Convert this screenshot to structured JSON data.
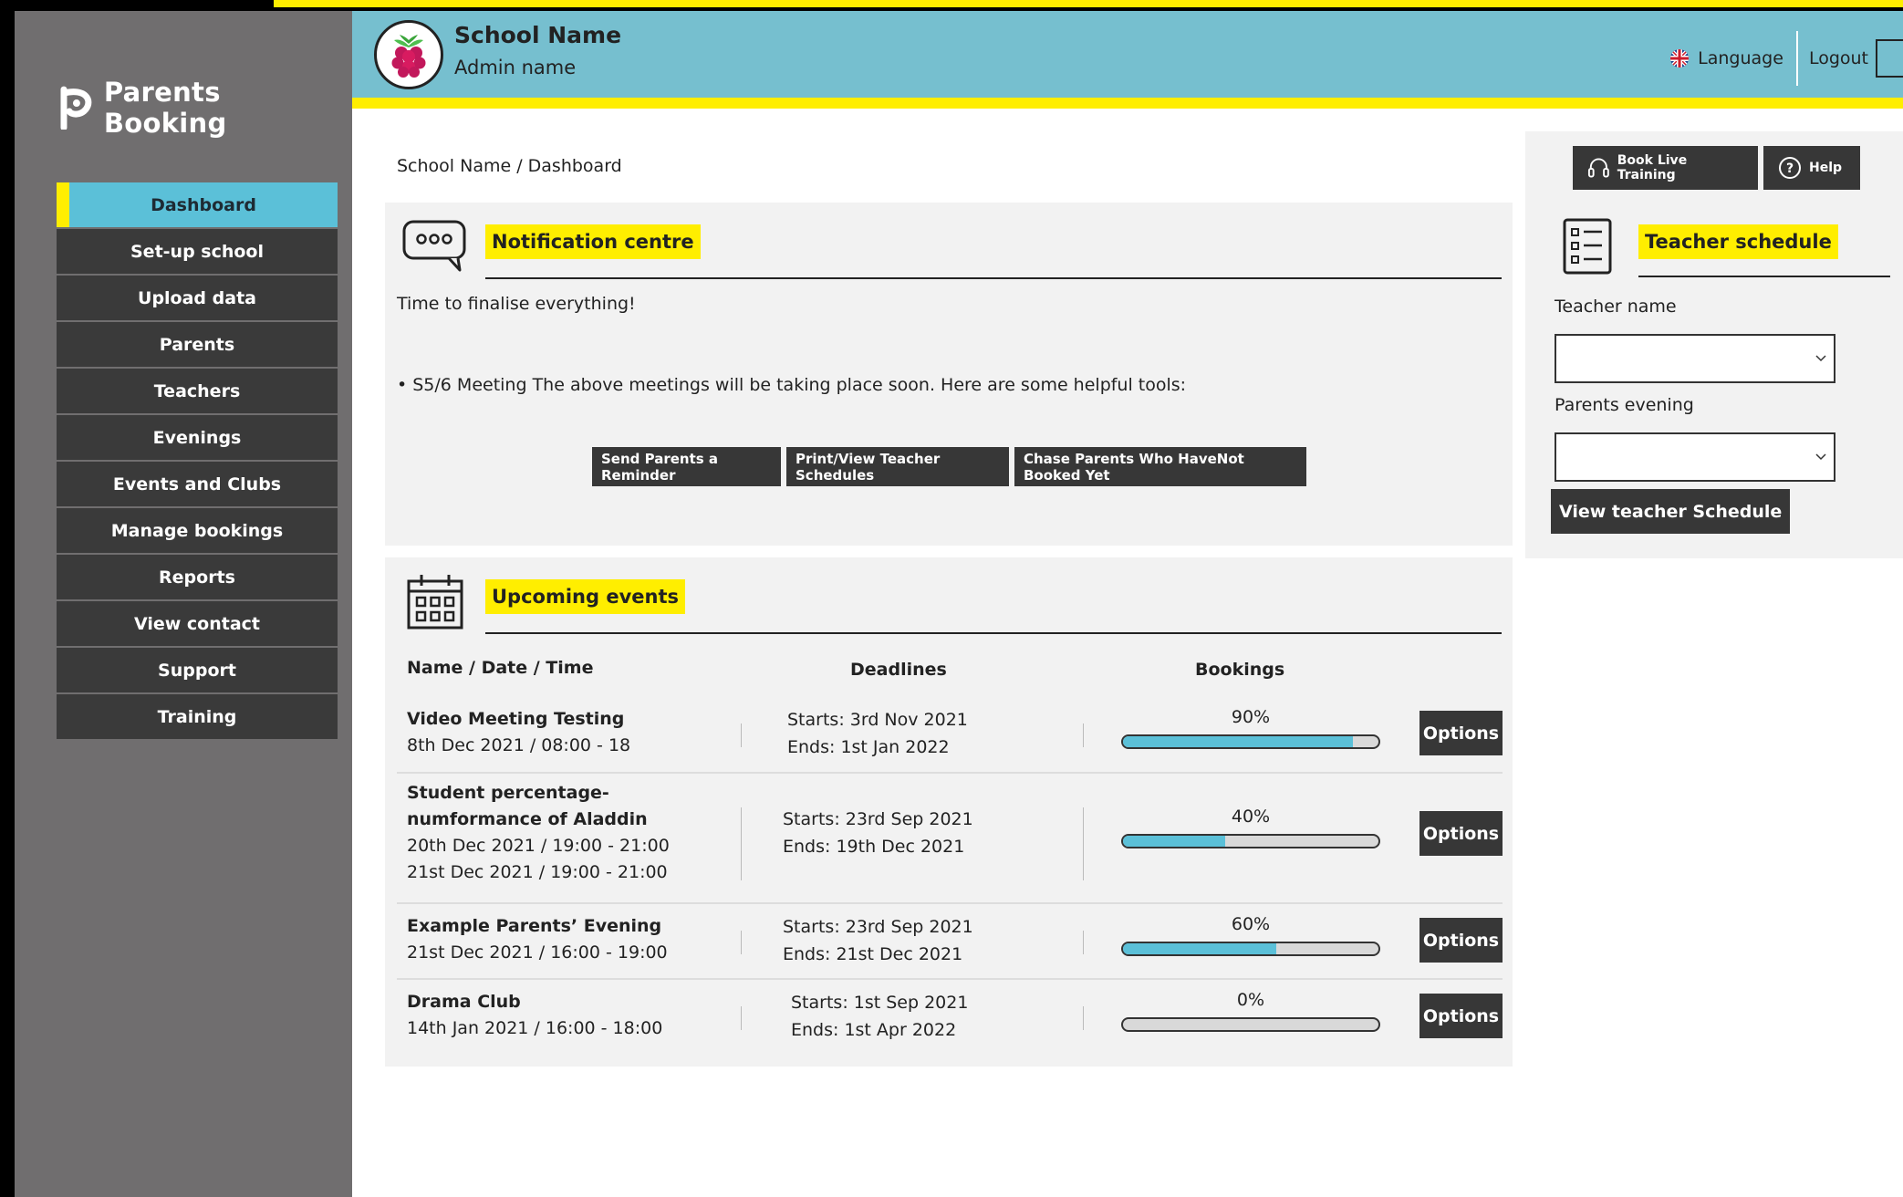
{
  "brand": {
    "name": "Parents Booking",
    "logo_icon": "parents-booking-logo-icon"
  },
  "header": {
    "school_name": "School Name",
    "admin_name": "Admin name",
    "language_label": "Language",
    "logout_label": "Logout"
  },
  "sidebar": {
    "items": [
      {
        "label": "Dashboard",
        "active": true
      },
      {
        "label": "Set-up school"
      },
      {
        "label": "Upload data"
      },
      {
        "label": "Parents"
      },
      {
        "label": "Teachers"
      },
      {
        "label": "Evenings"
      },
      {
        "label": "Events and Clubs"
      },
      {
        "label": "Manage bookings"
      },
      {
        "label": "Reports"
      },
      {
        "label": "View contact"
      },
      {
        "label": "Support"
      },
      {
        "label": "Training"
      }
    ]
  },
  "breadcrumb": "School Name / Dashboard",
  "notifications": {
    "title": "Notification centre",
    "message": "Time to finalise everything!",
    "meeting_note": "• S5/6 Meeting The above meetings will be taking place soon. Here are some helpful tools:",
    "buttons": [
      "Send Parents a Reminder",
      "Print/View Teacher Schedules",
      "Chase Parents Who HaveNot Booked Yet"
    ]
  },
  "events": {
    "title": "Upcoming events",
    "columns": {
      "name": "Name / Date / Time",
      "deadlines": "Deadlines",
      "bookings": "Bookings"
    },
    "options_label": "Options",
    "rows": [
      {
        "name": "Video Meeting Testing",
        "dates": [
          "8th Dec 2021 / 08:00 - 18"
        ],
        "starts": "Starts: 3rd Nov 2021",
        "ends": "Ends: 1st Jan 2022",
        "percent_label": "90%",
        "percent": 90
      },
      {
        "name": "Student percentage-numformance of Aladdin",
        "name_lines": [
          "Student percentage-",
          "numformance of Aladdin"
        ],
        "dates": [
          "20th Dec 2021 / 19:00 - 21:00",
          "21st Dec 2021 / 19:00 - 21:00"
        ],
        "starts": "Starts: 23rd Sep 2021",
        "ends": "Ends: 19th Dec 2021",
        "percent_label": "40%",
        "percent": 40
      },
      {
        "name": "Example Parents’ Evening",
        "dates": [
          "21st Dec 2021 / 16:00 - 19:00"
        ],
        "starts": "Starts: 23rd Sep 2021",
        "ends": "Ends: 21st Dec 2021",
        "percent_label": "60%",
        "percent": 60
      },
      {
        "name": "Drama Club",
        "dates": [
          "14th Jan 2021 / 16:00 - 18:00"
        ],
        "starts": "Starts: 1st Sep 2021",
        "ends": "Ends: 1st Apr 2022",
        "percent_label": "0%",
        "percent": 0
      }
    ]
  },
  "teacher_schedule": {
    "title": "Teacher schedule",
    "book_training_label": "Book Live Training",
    "help_label": "Help",
    "teacher_name_label": "Teacher name",
    "teacher_name_value": "",
    "parents_evening_label": "Parents evening",
    "parents_evening_value": "",
    "view_button": "View teacher Schedule"
  },
  "colors": {
    "accent_yellow": "#ffee00",
    "header_blue": "#76bfcf",
    "bar_blue": "#5bc0d8",
    "sidebar_gray": "#706e6f",
    "dark_button": "#373737"
  }
}
